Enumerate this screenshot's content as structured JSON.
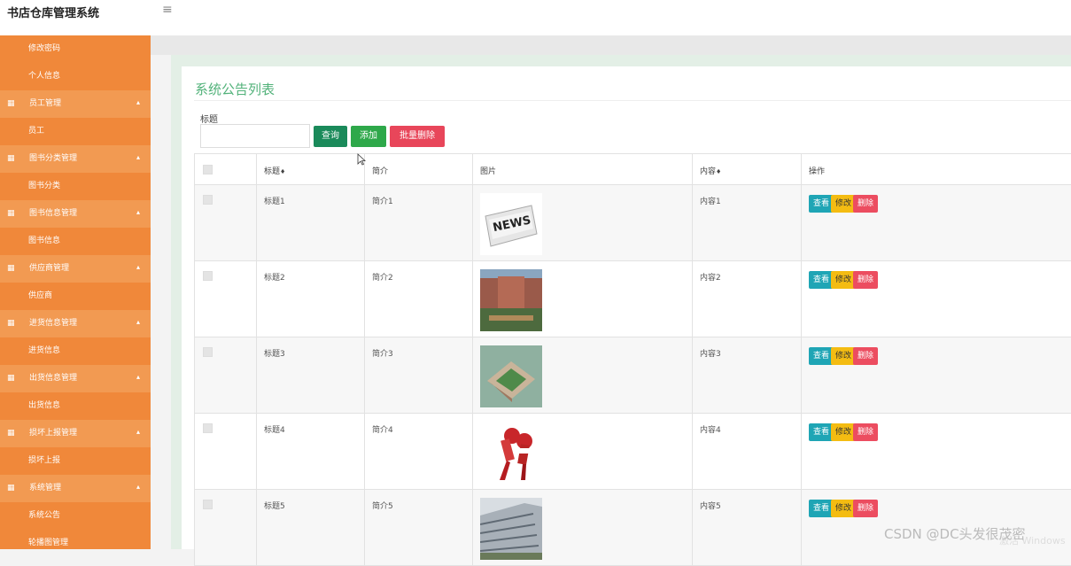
{
  "app": {
    "title": "书店仓库管理系统"
  },
  "sidebar": {
    "items": [
      {
        "type": "sub",
        "label": "修改密码"
      },
      {
        "type": "sub",
        "label": "个人信息"
      },
      {
        "type": "group",
        "label": "员工管理"
      },
      {
        "type": "sub",
        "label": "员工"
      },
      {
        "type": "group",
        "label": "图书分类管理"
      },
      {
        "type": "sub",
        "label": "图书分类"
      },
      {
        "type": "group",
        "label": "图书信息管理"
      },
      {
        "type": "sub",
        "label": "图书信息"
      },
      {
        "type": "group",
        "label": "供应商管理"
      },
      {
        "type": "sub",
        "label": "供应商"
      },
      {
        "type": "group",
        "label": "进货信息管理"
      },
      {
        "type": "sub",
        "label": "进货信息"
      },
      {
        "type": "group",
        "label": "出货信息管理"
      },
      {
        "type": "sub",
        "label": "出货信息"
      },
      {
        "type": "group",
        "label": "损坏上报管理"
      },
      {
        "type": "sub",
        "label": "损坏上报"
      },
      {
        "type": "group",
        "label": "系统管理"
      },
      {
        "type": "sub",
        "label": "系统公告"
      },
      {
        "type": "sub",
        "label": "轮播图管理"
      }
    ]
  },
  "main": {
    "title": "系统公告列表",
    "search": {
      "label": "标题",
      "value": ""
    },
    "buttons": {
      "query": "查询",
      "add": "添加",
      "bulk_delete": "批量删除"
    },
    "table": {
      "headers": [
        "",
        "标题",
        "简介",
        "图片",
        "内容",
        "操作"
      ],
      "sortable": [
        false,
        true,
        false,
        false,
        true,
        false
      ],
      "rows": [
        {
          "title": "标题1",
          "intro": "简介1",
          "image": "newspaper-image",
          "content": "内容1"
        },
        {
          "title": "标题2",
          "intro": "简介2",
          "image": "campus-building-image",
          "content": "内容2"
        },
        {
          "title": "标题3",
          "intro": "简介3",
          "image": "aerial-campus-image",
          "content": "内容3"
        },
        {
          "title": "标题4",
          "intro": "简介4",
          "image": "live-microphone-image",
          "content": "内容4"
        },
        {
          "title": "标题5",
          "intro": "简介5",
          "image": "modern-building-image",
          "content": "内容5"
        }
      ],
      "actions": {
        "view": "查看",
        "edit": "修改",
        "delete": "删除"
      }
    }
  },
  "watermark": {
    "text": "CSDN @DC头发很茂密",
    "windows": "激活 Windows"
  },
  "colors": {
    "sidebar": "#f0883a",
    "sidebar_group": "#f29a52",
    "title": "#52b27a",
    "view": "#1fa5b5",
    "edit": "#f4bc12",
    "delete": "#ec4d60"
  }
}
